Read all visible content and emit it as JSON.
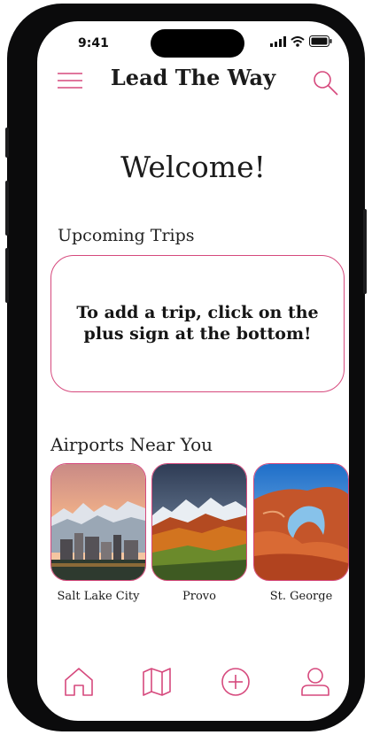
{
  "status": {
    "time": "9:41"
  },
  "header": {
    "title": "Lead The Way"
  },
  "welcome": "Welcome!",
  "upcoming": {
    "title": "Upcoming Trips",
    "empty_message": "To add a trip, click on the plus sign at the bottom!"
  },
  "airports": {
    "title": "Airports Near You",
    "items": [
      {
        "name": "Salt Lake City"
      },
      {
        "name": "Provo"
      },
      {
        "name": "St. George"
      }
    ]
  },
  "colors": {
    "accent": "#d6497d",
    "text": "#1b1b1b",
    "frame": "#0b0b0c"
  },
  "icons": {
    "menu": "hamburger-icon",
    "search": "search-icon",
    "nav": [
      "home-icon",
      "map-icon",
      "plus-circle-icon",
      "profile-icon"
    ]
  }
}
